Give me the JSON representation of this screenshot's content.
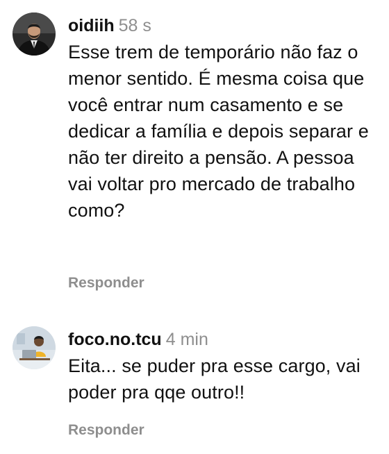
{
  "comments": [
    {
      "username": "oidiih",
      "time": "58 s",
      "text": "Esse trem de temporário não faz o menor sentido. É mesma coisa que você entrar num casamento e se dedicar a família e depois separar e não ter direito a pensão. A pessoa vai voltar pro mercado de trabalho como?",
      "reply_label": "Responder",
      "avatar_icon": "man-in-suit-avatar"
    },
    {
      "username": "foco.no.tcu",
      "time": "4 min",
      "text": "Eita... se puder pra esse cargo, vai poder pra qqe outro!!",
      "reply_label": "Responder",
      "avatar_icon": "woman-studying-laptop-avatar"
    }
  ]
}
